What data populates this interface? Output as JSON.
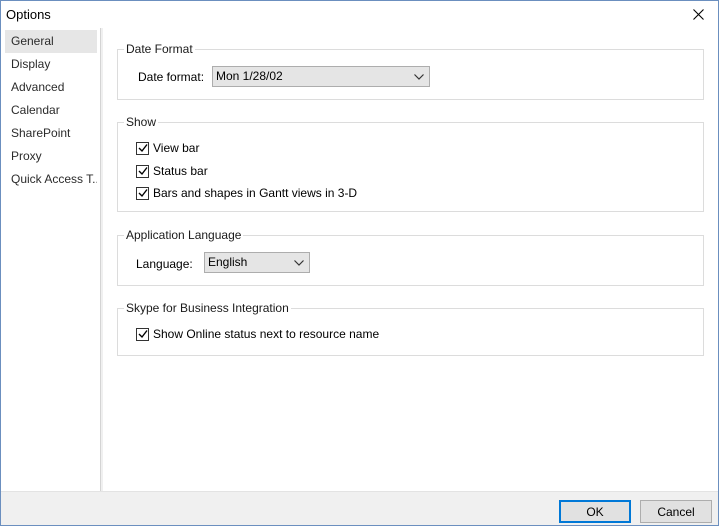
{
  "window": {
    "title": "Options",
    "close_icon": "close-icon"
  },
  "sidebar": {
    "items": [
      {
        "label": "General",
        "active": true
      },
      {
        "label": "Display",
        "active": false
      },
      {
        "label": "Advanced",
        "active": false
      },
      {
        "label": "Calendar",
        "active": false
      },
      {
        "label": "SharePoint",
        "active": false
      },
      {
        "label": "Proxy",
        "active": false
      },
      {
        "label": "Quick Access T...",
        "active": false
      }
    ]
  },
  "date_format": {
    "legend": "Date Format",
    "label": "Date format:",
    "value": "Mon 1/28/02"
  },
  "show": {
    "legend": "Show",
    "checkboxes": [
      {
        "label": "View bar",
        "checked": true
      },
      {
        "label": "Status bar",
        "checked": true
      },
      {
        "label": "Bars and shapes in Gantt views in 3-D",
        "checked": true
      }
    ]
  },
  "application_language": {
    "legend": "Application Language",
    "label": "Language:",
    "value": "English"
  },
  "skype": {
    "legend": "Skype for Business Integration",
    "checkboxes": [
      {
        "label": "Show Online status next to resource name",
        "checked": true
      }
    ]
  },
  "footer": {
    "ok_label": "OK",
    "cancel_label": "Cancel"
  },
  "colors": {
    "accent": "#0078d7",
    "sidebar_selected": "#e6e6e6",
    "footer_bg": "#f0f0f0"
  }
}
